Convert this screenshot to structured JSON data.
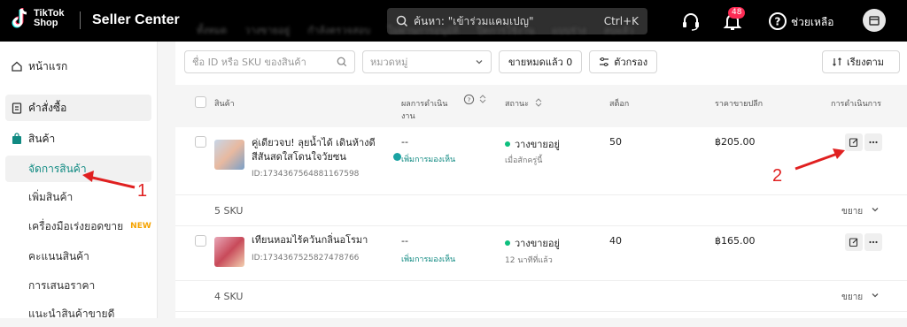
{
  "topbar": {
    "brand_line1": "TikTok",
    "brand_line2": "Shop",
    "app_title": "Seller Center",
    "search_text": "ค้นหา: \"เข้าร่วมแคมเปญ\"",
    "shortcut": "Ctrl+K",
    "notif_count": "48",
    "help_label": "ช่วยเหลือ"
  },
  "sidebar": {
    "home": "หน้าแรก",
    "orders": "คำสั่งซื้อ",
    "products": "สินค้า",
    "sub": [
      "จัดการสินค้า",
      "เพิ่มสินค้า",
      "เครื่องมือเร่งยอดขาย",
      "คะแนนสินค้า",
      "การเสนอราคา",
      "แนะนำสินค้าขายดี"
    ],
    "new_tag": "NEW"
  },
  "tabs": [
    "ทั้งหมด",
    "วางขายอยู่",
    "กำลังตรวจสอบ",
    "ไม่ผ่านการอนุมัติ",
    "ปิดการใช้งาน",
    "แบบร่าง",
    "ลบแล้ว"
  ],
  "filters": {
    "search_placeholder": "ชื่อ ID หรือ SKU ของสินค้า",
    "category_placeholder": "หมวดหมู่",
    "soldout": "ขายหมดแล้ว 0",
    "filter_btn": "ตัวกรอง",
    "sort_btn": "เรียงตาม"
  },
  "table": {
    "headers": [
      "สินค้า",
      "ผลการดำเนิน",
      "งาน",
      "สถานะ",
      "สต็อก",
      "ราคาขายปลีก",
      "การดำเนินการ"
    ]
  },
  "products": [
    {
      "name1": "คู่เดียวจบ! ลุยน้ำได้ เดินห้างดี",
      "name2": "สีสันสดใสโดนใจวัยซน",
      "id": "ID:1734367564881167598",
      "perf": "--",
      "perf_link": "เพิ่มการมองเห็น",
      "status": "วางขายอยู่",
      "status_time": "เมื่อสักครู่นี้",
      "stock": "50",
      "price": "฿205.00",
      "sku": "5 SKU",
      "expand": "ขยาย"
    },
    {
      "name1": "เทียนหอมไร้ควันกลิ่นอโรมา",
      "name2": "",
      "id": "ID:1734367525827478766",
      "perf": "--",
      "perf_link": "เพิ่มการมองเห็น",
      "status": "วางขายอยู่",
      "status_time": "12 นาทีที่แล้ว",
      "stock": "40",
      "price": "฿165.00",
      "sku": "4 SKU",
      "expand": "ขยาย"
    }
  ],
  "annotations": [
    "1",
    "2"
  ]
}
